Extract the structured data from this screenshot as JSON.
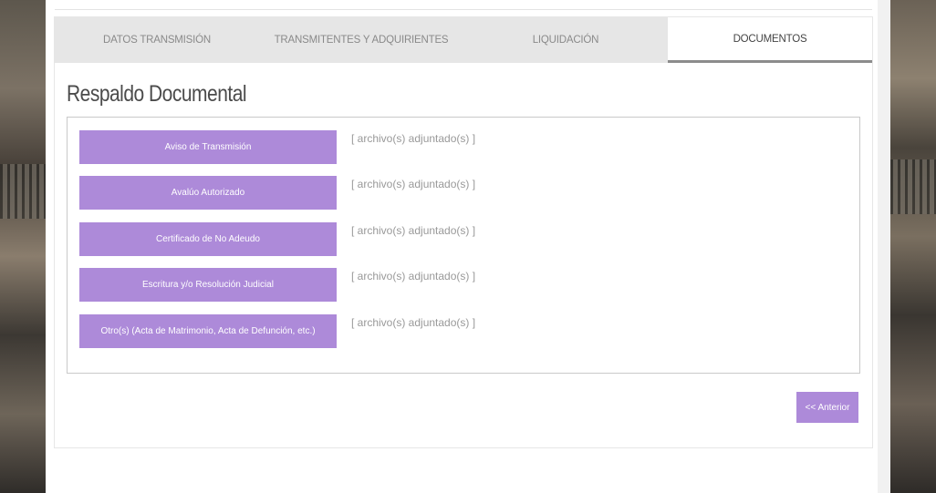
{
  "tabs": [
    {
      "label": "DATOS TRANSMISIÓN",
      "active": false
    },
    {
      "label": "TRANSMITENTES Y ADQUIRIENTES",
      "active": false
    },
    {
      "label": "LIQUIDACIÓN",
      "active": false
    },
    {
      "label": "DOCUMENTOS",
      "active": true
    }
  ],
  "section": {
    "title": "Respaldo Documental"
  },
  "documents": [
    {
      "label": "Aviso de Transmisión",
      "status": "[ archivo(s) adjuntado(s) ]"
    },
    {
      "label": "Avalúo Autorizado",
      "status": "[ archivo(s) adjuntado(s) ]"
    },
    {
      "label": "Certificado de No Adeudo",
      "status": "[ archivo(s) adjuntado(s) ]"
    },
    {
      "label": "Escritura y/o Resolución Judicial",
      "status": "[ archivo(s) adjuntado(s) ]"
    },
    {
      "label": "Otro(s) (Acta de Matrimonio, Acta de Defunción, etc.)",
      "status": "[ archivo(s) adjuntado(s) ]"
    }
  ],
  "nav": {
    "previous_label": "<< Anterior"
  },
  "colors": {
    "accent": "#ad8ad9",
    "tab_bar": "#e6e6e6",
    "active_tab_underline": "#8c8c8c"
  }
}
